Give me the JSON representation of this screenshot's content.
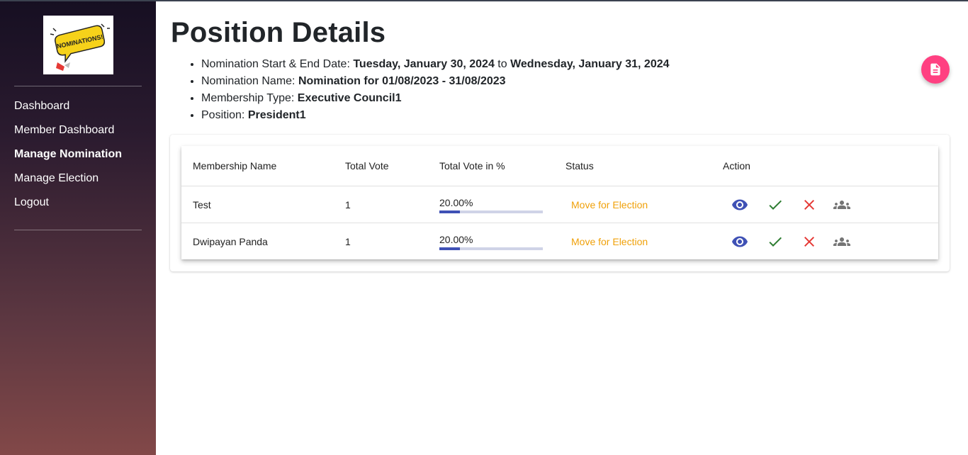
{
  "sidebar": {
    "logo_text": "NOMINATIONS!",
    "items": [
      {
        "label": "Dashboard",
        "active": false
      },
      {
        "label": "Member Dashboard",
        "active": false
      },
      {
        "label": "Manage Nomination",
        "active": true
      },
      {
        "label": "Manage Election",
        "active": false
      },
      {
        "label": "Logout",
        "active": false
      }
    ]
  },
  "page": {
    "title": "Position Details",
    "details": [
      {
        "label": "Nomination Start & End Date: ",
        "value": "Tuesday, January 30, 2024",
        "sep": " to ",
        "value2": "Wednesday, January 31, 2024"
      },
      {
        "label": "Nomination Name: ",
        "value": "Nomination for 01/08/2023 - 31/08/2023"
      },
      {
        "label": "Membership Type: ",
        "value": "Executive Council1"
      },
      {
        "label": "Position: ",
        "value": "President1"
      }
    ],
    "fab_icon": "document-icon"
  },
  "table": {
    "headers": [
      "Membership Name",
      "Total Vote",
      "Total Vote in %",
      "Status",
      "Action"
    ],
    "rows": [
      {
        "name": "Test",
        "votes": "1",
        "percent_text": "20.00%",
        "percent": 20,
        "status": "Move for Election"
      },
      {
        "name": "Dwipayan Panda",
        "votes": "1",
        "percent_text": "20.00%",
        "percent": 20,
        "status": "Move for Election"
      }
    ],
    "action_icons": [
      "eye-icon",
      "check-icon",
      "close-icon",
      "group-icon"
    ]
  },
  "colors": {
    "accent": "#3f51b5",
    "status": "#f0a10a",
    "fab": "#ff4081",
    "approve": "#2e7d32",
    "reject": "#e53935",
    "group": "#757575"
  }
}
